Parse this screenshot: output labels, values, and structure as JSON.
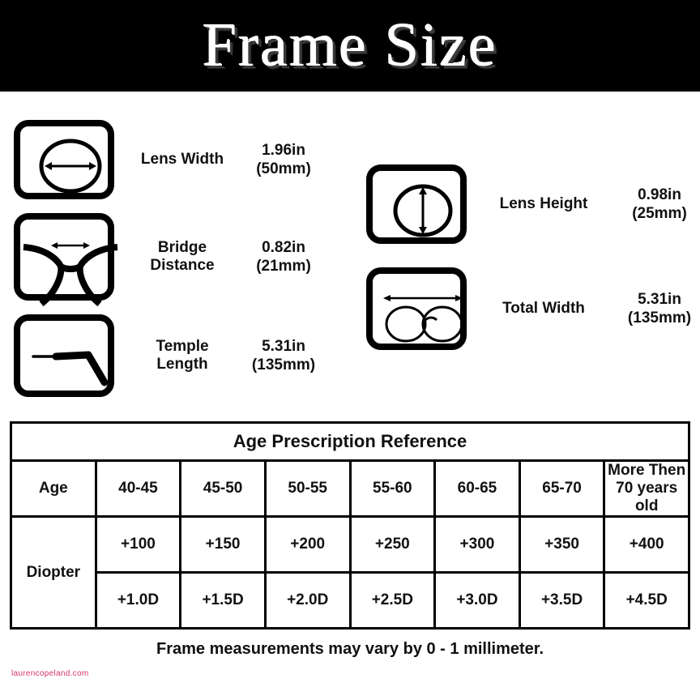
{
  "header": {
    "title": "Frame Size"
  },
  "measurements": {
    "left": [
      {
        "icon": "lens-width-icon",
        "label": "Lens Width",
        "value_in": "1.96in",
        "value_mm": "(50mm)"
      },
      {
        "icon": "bridge-distance-icon",
        "label": "Bridge\nDistance",
        "label_line1": "Bridge",
        "label_line2": "Distance",
        "value_in": "0.82in",
        "value_mm": "(21mm)"
      },
      {
        "icon": "temple-length-icon",
        "label_line1": "Temple",
        "label_line2": "Length",
        "value_in": "5.31in",
        "value_mm": "(135mm)"
      }
    ],
    "right": [
      {
        "icon": "lens-height-icon",
        "label": "Lens Height",
        "value_in": "0.98in",
        "value_mm": "(25mm)"
      },
      {
        "icon": "total-width-icon",
        "label": "Total Width",
        "value_in": "5.31in",
        "value_mm": "(135mm)"
      }
    ]
  },
  "table": {
    "title": "Age Prescription Reference",
    "row_headers": {
      "age": "Age",
      "diopter": "Diopter"
    },
    "age_ranges": [
      "40-45",
      "45-50",
      "50-55",
      "55-60",
      "60-65",
      "65-70"
    ],
    "age_last_line1": "More Then",
    "age_last_line2": "70 years old",
    "diopter_numeric": [
      "+100",
      "+150",
      "+200",
      "+250",
      "+300",
      "+350",
      "+400"
    ],
    "diopter_d": [
      "+1.0D",
      "+1.5D",
      "+2.0D",
      "+2.5D",
      "+3.0D",
      "+3.5D",
      "+4.5D"
    ]
  },
  "footer": {
    "note": "Frame measurements may vary by 0 - 1 millimeter.",
    "watermark": "laurencopeland.com"
  },
  "colors": {
    "banner_bg": "#000000",
    "banner_text": "#ffffff",
    "ink": "#111111",
    "watermark": "#d6336c"
  }
}
